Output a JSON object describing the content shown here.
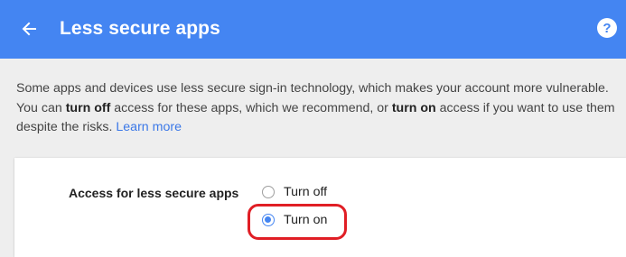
{
  "header": {
    "title": "Less secure apps",
    "back_icon": "arrow-left-icon",
    "help_icon": "help-icon",
    "help_glyph": "?",
    "bg_color": "#4485f2"
  },
  "description": {
    "part1": "Some apps and devices use less secure sign-in technology, which makes your account more vulnerable. You can ",
    "bold1": "turn off",
    "part2": " access for these apps, which we recommend, or ",
    "bold2": "turn on",
    "part3": " access if you want to use them despite the risks. ",
    "link": "Learn more"
  },
  "setting": {
    "label": "Access for less secure apps",
    "options": [
      {
        "label": "Turn off",
        "selected": false
      },
      {
        "label": "Turn on",
        "selected": true
      }
    ],
    "highlight_color": "#e01e25"
  }
}
